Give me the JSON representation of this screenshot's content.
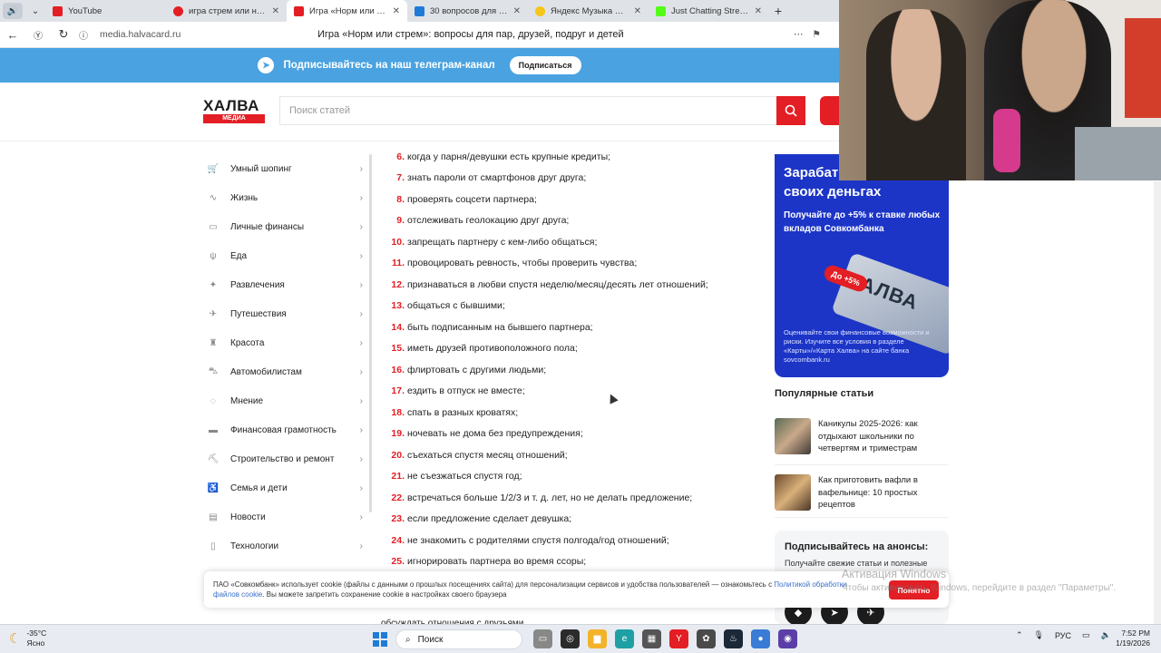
{
  "browser": {
    "tabs": [
      {
        "label": "YouTube",
        "color": "#e31e24"
      },
      {
        "label": "игра стрем или норм вопросы",
        "color": "#e31e24"
      },
      {
        "label": "Игра «Норм или стрем»: вопросы",
        "color": "#e31e24",
        "active": true
      },
      {
        "label": "30 вопросов для игры «Стрем»",
        "color": "#1e7bd6"
      },
      {
        "label": "Яндекс Музыка — собираем",
        "color": "#f5c518"
      },
      {
        "label": "Just Chatting Streaming - Twitch",
        "color": "#53fc18"
      }
    ],
    "url": "media.halvacard.ru",
    "page_title": "Игра «Норм или стрем»: вопросы для пар, друзей, подруг и детей"
  },
  "telegram": {
    "text": "Подписывайтесь на наш телеграм-канал",
    "button": "Подписаться"
  },
  "header": {
    "logo_text": "ХАЛВА",
    "logo_sub": "МЕДИА",
    "search_placeholder": "Поиск статей"
  },
  "sidebar": {
    "items": [
      {
        "label": "Умный шопинг",
        "icon": "cart-icon"
      },
      {
        "label": "Жизнь",
        "icon": "pulse-icon"
      },
      {
        "label": "Личные финансы",
        "icon": "wallet-icon"
      },
      {
        "label": "Еда",
        "icon": "food-icon"
      },
      {
        "label": "Развлечения",
        "icon": "party-icon"
      },
      {
        "label": "Путешествия",
        "icon": "plane-icon"
      },
      {
        "label": "Красота",
        "icon": "beauty-icon"
      },
      {
        "label": "Автомобилистам",
        "icon": "car-icon"
      },
      {
        "label": "Мнение",
        "icon": "chat-icon"
      },
      {
        "label": "Финансовая грамотность",
        "icon": "card-icon"
      },
      {
        "label": "Строительство и ремонт",
        "icon": "build-icon"
      },
      {
        "label": "Семья и дети",
        "icon": "stroller-icon"
      },
      {
        "label": "Новости",
        "icon": "news-icon"
      },
      {
        "label": "Технологии",
        "icon": "phone-icon"
      }
    ]
  },
  "list": {
    "items": [
      {
        "n": "6.",
        "t": "когда у парня/девушки есть крупные кредиты;"
      },
      {
        "n": "7.",
        "t": "знать пароли от смартфонов друг друга;"
      },
      {
        "n": "8.",
        "t": "проверять соцсети партнера;"
      },
      {
        "n": "9.",
        "t": "отслеживать геолокацию друг друга;"
      },
      {
        "n": "10.",
        "t": "запрещать партнеру с кем-либо общаться;"
      },
      {
        "n": "11.",
        "t": "провоцировать ревность, чтобы проверить чувства;"
      },
      {
        "n": "12.",
        "t": "признаваться в любви спустя неделю/месяц/десять лет отношений;"
      },
      {
        "n": "13.",
        "t": "общаться с бывшими;"
      },
      {
        "n": "14.",
        "t": "быть подписанным на бывшего партнера;"
      },
      {
        "n": "15.",
        "t": "иметь друзей противоположного пола;"
      },
      {
        "n": "16.",
        "t": "флиртовать с другими людьми;"
      },
      {
        "n": "17.",
        "t": "ездить в отпуск не вместе;"
      },
      {
        "n": "18.",
        "t": "спать в разных кроватях;"
      },
      {
        "n": "19.",
        "t": "ночевать не дома без предупреждения;"
      },
      {
        "n": "20.",
        "t": "съехаться спустя месяц отношений;"
      },
      {
        "n": "21.",
        "t": "не съезжаться спустя год;"
      },
      {
        "n": "22.",
        "t": "встречаться больше 1/2/3 и т. д. лет, но не делать предложение;"
      },
      {
        "n": "23.",
        "t": "если предложение сделает девушка;"
      },
      {
        "n": "24.",
        "t": "не знакомить с родителями спустя полгода/год отношений;"
      },
      {
        "n": "25.",
        "t": "игнорировать партнера во время ссоры;"
      }
    ],
    "partial_bottom": "обсуждать отношения с друзьями"
  },
  "ad": {
    "heading": "Зарабатывайте на своих деньгах",
    "sub": "Получайте до +5% к ставке любых вкладов Совкомбанка",
    "badge": "До +5%",
    "card_text": "ХАЛВА",
    "fine": "Оценивайте свои финансовые возможности и риски. Изучите все условия в разделе «Карты»/«Карта Халва» на сайте банка sovcombank.ru"
  },
  "popular": {
    "heading": "Популярные статьи",
    "items": [
      {
        "title": "Каникулы 2025-2026: как отдыхают школьники по четвертям и триместрам"
      },
      {
        "title": "Как приготовить вафли в вафельнице: 10 простых рецептов"
      }
    ]
  },
  "subscribe": {
    "heading": "Подписывайтесь на анонсы:",
    "text": "Получайте свежие статьи и полезные"
  },
  "cookie": {
    "text1": "ПАО «Совкомбанк» использует cookie (файлы с данными о прошлых посещениях сайта) для персонализации сервисов и удобства пользователей — ознакомьтесь с ",
    "link1": "Политикой обработки",
    "link2": "файлов cookie",
    "text2": ". Вы можете запретить сохранение cookie в настройках своего браузера",
    "button": "Понятно"
  },
  "watermark": {
    "line1": "Активация Windows",
    "line2": "Чтобы активировать Windows, перейдите в раздел \"Параметры\"."
  },
  "taskbar": {
    "temp": "-35°C",
    "weather": "Ясно",
    "search": "Поиск",
    "lang": "РУС",
    "time": "7:52 PM",
    "date": "1/19/2026"
  },
  "colors": {
    "accent": "#e31e24",
    "telegram": "#4aa3e0",
    "ad_bg": "#1c35c7"
  }
}
